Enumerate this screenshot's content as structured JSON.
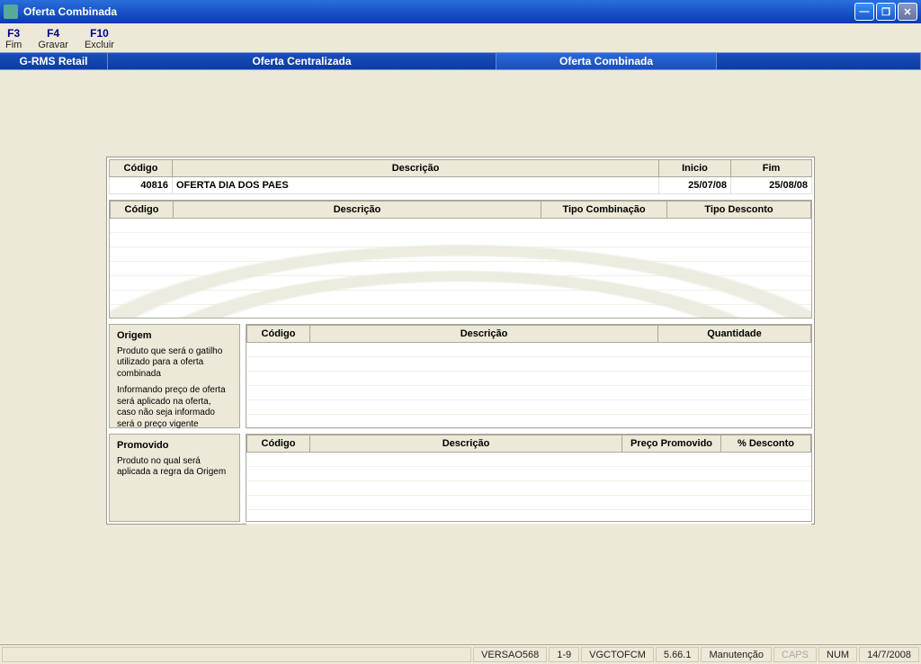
{
  "window": {
    "title": "Oferta Combinada"
  },
  "fkeys": {
    "f3": {
      "key": "F3",
      "label": "Fim"
    },
    "f4": {
      "key": "F4",
      "label": "Gravar"
    },
    "f10": {
      "key": "F10",
      "label": "Excluir"
    }
  },
  "nav": {
    "app": "G-RMS Retail",
    "crumb1": "Oferta Centralizada",
    "crumb2": "Oferta Combinada"
  },
  "oferta_header": {
    "cols": {
      "codigo": "Código",
      "descricao": "Descrição",
      "inicio": "Inicio",
      "fim": "Fim"
    },
    "row": {
      "codigo": "40816",
      "descricao": "OFERTA DIA DOS PAES",
      "inicio": "25/07/08",
      "fim": "25/08/08"
    }
  },
  "combo_grid": {
    "cols": {
      "codigo": "Código",
      "descricao": "Descrição",
      "tipo_comb": "Tipo Combinação",
      "tipo_desc": "Tipo Desconto"
    }
  },
  "origem": {
    "heading": "Origem",
    "text1": "Produto que será o gatilho utilizado para a oferta combinada",
    "text2": "Informando preço de oferta será aplicado na oferta, caso não seja informado será o preço vigente",
    "grid_cols": {
      "codigo": "Código",
      "descricao": "Descrição",
      "quantidade": "Quantidade"
    }
  },
  "promovido": {
    "heading": "Promovido",
    "text": "Produto no qual será aplicada a regra da Origem",
    "grid_cols": {
      "codigo": "Código",
      "descricao": "Descrição",
      "preco": "Preço Promovido",
      "desconto": "% Desconto"
    }
  },
  "status": {
    "version": "VERSAO568",
    "range": "1-9",
    "module": "VGCTOFCM",
    "ver_num": "5.66.1",
    "mode": "Manutenção",
    "caps": "CAPS",
    "num": "NUM",
    "date": "14/7/2008"
  }
}
